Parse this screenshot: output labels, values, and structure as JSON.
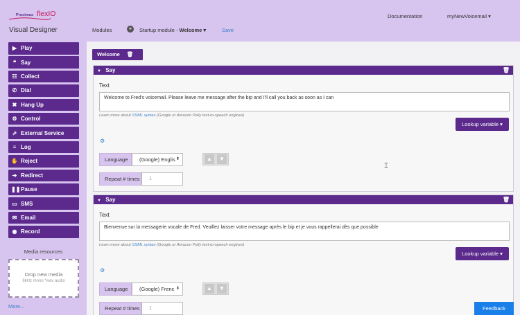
{
  "brand": {
    "word1": "Proximus",
    "word2": "flexIO"
  },
  "sidebar": {
    "title": "Visual Designer",
    "actions": [
      {
        "label": "Play",
        "icon": "play-icon",
        "glyph": "▶"
      },
      {
        "label": "Say",
        "icon": "quote-icon",
        "glyph": "❝"
      },
      {
        "label": "Collect",
        "icon": "keypad-icon",
        "glyph": "☷"
      },
      {
        "label": "Dial",
        "icon": "phone-icon",
        "glyph": "✆"
      },
      {
        "label": "Hang Up",
        "icon": "hangup-icon",
        "glyph": "✖"
      },
      {
        "label": "Control",
        "icon": "cog-icon",
        "glyph": "⚙"
      },
      {
        "label": "External Service",
        "icon": "external-link-icon",
        "glyph": "⇗"
      },
      {
        "label": "Log",
        "icon": "list-icon",
        "glyph": "≡"
      },
      {
        "label": "Reject",
        "icon": "thumbs-down-icon",
        "glyph": "✋"
      },
      {
        "label": "Redirect",
        "icon": "redirect-icon",
        "glyph": "➔"
      },
      {
        "label": "Pause",
        "icon": "pause-icon",
        "glyph": "❚❚"
      },
      {
        "label": "SMS",
        "icon": "sms-icon",
        "glyph": "▭"
      },
      {
        "label": "Email",
        "icon": "envelope-icon",
        "glyph": "✉"
      },
      {
        "label": "Record",
        "icon": "record-icon",
        "glyph": "◉"
      }
    ],
    "media_title": "Media resources",
    "drop_main": "Drop new media",
    "drop_sub": "8kHz mono *wav audio",
    "more": "More..."
  },
  "topbar": {
    "documentation": "Documentation",
    "user": "myNewVoicemail ▾",
    "modules": "Modules",
    "startup_prefix": "Startup module - ",
    "startup_name": "Welcome ▾",
    "save": "Save"
  },
  "main": {
    "module_name": "Welcome",
    "panels": [
      {
        "title": "Say",
        "text_label": "Text",
        "text_value": "Welcome to Fred's voicemail. Please leave me message after the bip and I'll call you back as soon as I can",
        "hint_prefix": "Learn more about ",
        "hint_link": "SSML syntax",
        "hint_suffix": " (Google or Amazon Polly text-to-speech engines)",
        "lookup": "Lookup variable ▾",
        "language_label": "Language",
        "language_value": "(Google) Englis",
        "repeat_label": "Repeat # times",
        "repeat_placeholder": "1"
      },
      {
        "title": "Say",
        "text_label": "Text",
        "text_value": "Bienvenue sur la messagerie vocale de Fred. Veuillez laisser votre message après le bip et je vous rappellerai dès que possible",
        "hint_prefix": "Learn more about ",
        "hint_link": "SSML syntax",
        "hint_suffix": " (Google or Amazon Polly text-to-speech engines)",
        "lookup": "Lookup variable ▾",
        "language_label": "Language",
        "language_value": "(Google) Frenc",
        "repeat_label": "Repeat # times",
        "repeat_placeholder": "1"
      }
    ]
  },
  "feedback": "Feedback",
  "colors": {
    "accent": "#5b2a8c",
    "lavender": "#d7c4ef",
    "link": "#3a7fc4",
    "feedback": "#1a7fe8",
    "brand": "#c8185a"
  }
}
